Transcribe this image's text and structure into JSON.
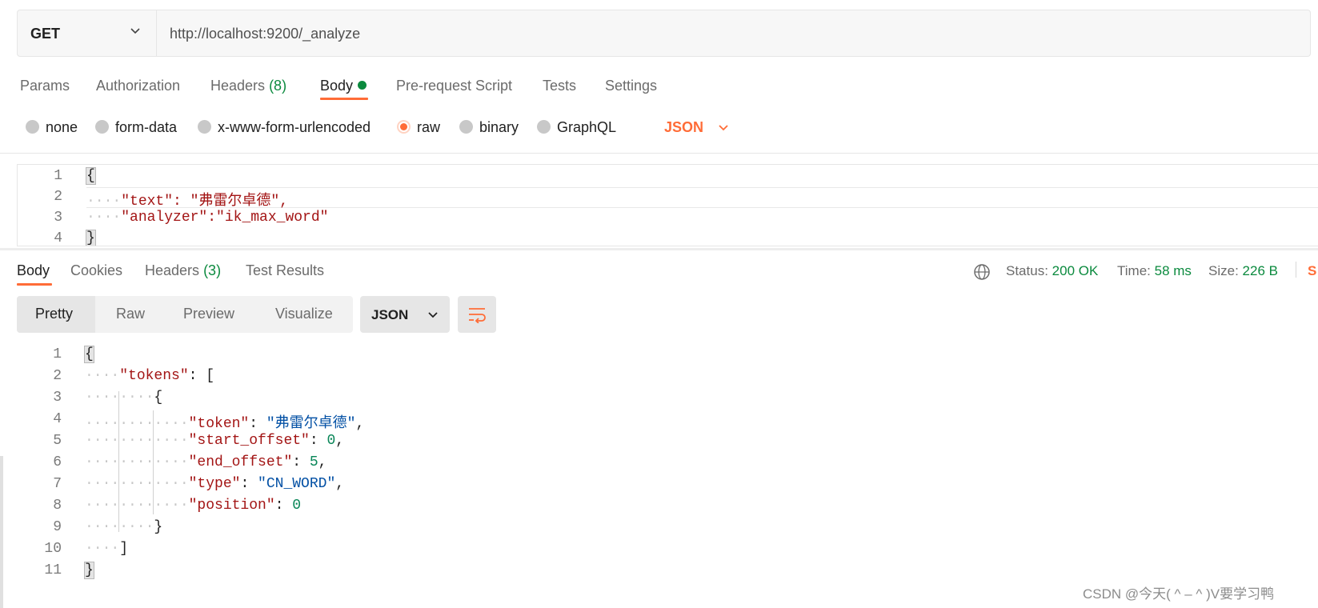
{
  "request": {
    "method": "GET",
    "url": "http://localhost:9200/_analyze"
  },
  "request_tabs": {
    "params": "Params",
    "authorization": "Authorization",
    "headers": "Headers",
    "headers_count": "(8)",
    "body": "Body",
    "prerequest": "Pre-request Script",
    "tests": "Tests",
    "settings": "Settings"
  },
  "body_types": {
    "none": "none",
    "form_data": "form-data",
    "urlencoded": "x-www-form-urlencoded",
    "raw": "raw",
    "binary": "binary",
    "graphql": "GraphQL",
    "language": "JSON",
    "selected": "raw"
  },
  "request_body": {
    "line_numbers": [
      "1",
      "2",
      "3",
      "4"
    ],
    "lines": [
      "{",
      "\"text\": \"弗雷尔卓德\",",
      "\"analyzer\":\"ik_max_word\"",
      "}"
    ]
  },
  "response_tabs": {
    "body": "Body",
    "cookies": "Cookies",
    "headers": "Headers",
    "headers_count": "(3)",
    "test_results": "Test Results"
  },
  "response_meta": {
    "status_label": "Status:",
    "status_value": "200 OK",
    "time_label": "Time:",
    "time_value": "58 ms",
    "size_label": "Size:",
    "size_value": "226 B",
    "save_truncated": "S"
  },
  "response_view": {
    "pretty": "Pretty",
    "raw": "Raw",
    "preview": "Preview",
    "visualize": "Visualize",
    "format": "JSON"
  },
  "response_body": {
    "line_numbers": [
      "1",
      "2",
      "3",
      "4",
      "5",
      "6",
      "7",
      "8",
      "9",
      "10",
      "11"
    ],
    "tokens_key": "\"tokens\"",
    "token_key": "\"token\"",
    "token_value": "\"弗雷尔卓德\"",
    "start_offset_key": "\"start_offset\"",
    "start_offset_value": "0",
    "end_offset_key": "\"end_offset\"",
    "end_offset_value": "5",
    "type_key": "\"type\"",
    "type_value": "\"CN_WORD\"",
    "position_key": "\"position\"",
    "position_value": "0"
  },
  "watermark": "CSDN @今天( ^ – ^ )V要学习鸭",
  "colors": {
    "accent": "#ff6c37",
    "success": "#0b8a3e",
    "json_key": "#a31515",
    "json_string": "#0451a5",
    "json_number": "#098658"
  }
}
